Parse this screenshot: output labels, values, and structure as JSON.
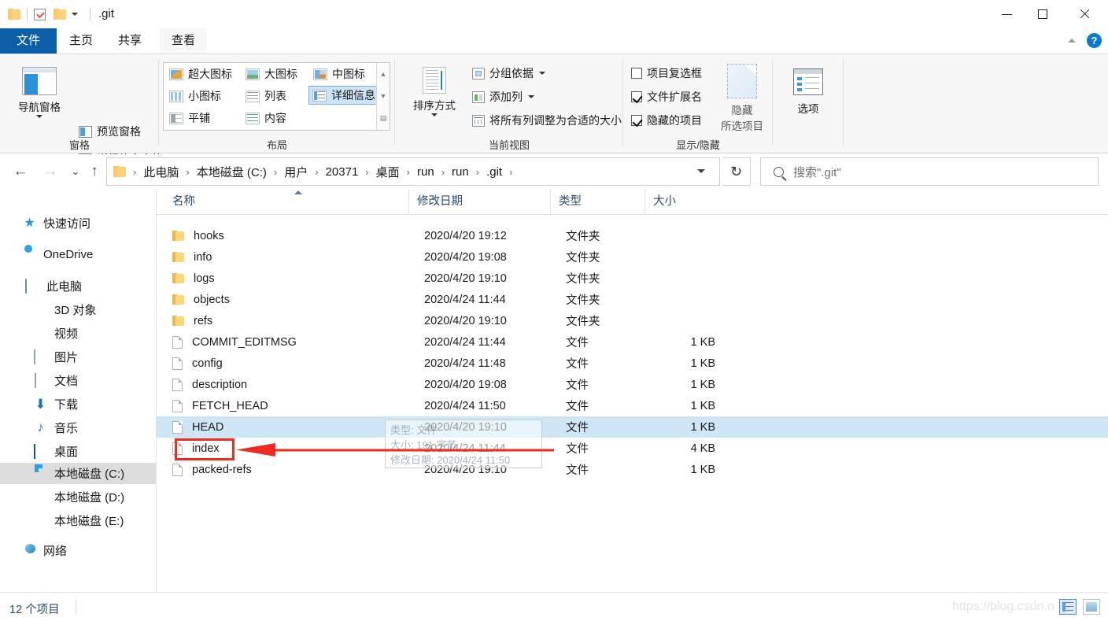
{
  "window": {
    "title": ".git",
    "quick_access": [
      "folder-icon",
      "properties-icon",
      "new-folder-icon"
    ],
    "controls": {
      "minimize": "minimize-icon",
      "maximize": "maximize-icon",
      "close": "close-icon"
    }
  },
  "tabs": [
    {
      "label": "文件",
      "name": "tab-file"
    },
    {
      "label": "主页",
      "name": "tab-home"
    },
    {
      "label": "共享",
      "name": "tab-share"
    },
    {
      "label": "查看",
      "name": "tab-view"
    }
  ],
  "ribbon": {
    "help_label": "?",
    "groups": [
      {
        "label": "窗格",
        "big_button": {
          "label1": "导航窗格",
          "icon": "nav-pane-icon"
        },
        "items": [
          {
            "label": "预览窗格",
            "icon": "preview-pane-icon"
          },
          {
            "label": "详细信息窗格",
            "icon": "details-pane-icon"
          }
        ]
      },
      {
        "label": "布局",
        "views": [
          {
            "label": "超大图标",
            "selected": false
          },
          {
            "label": "大图标",
            "selected": false
          },
          {
            "label": "中图标",
            "selected": false
          },
          {
            "label": "小图标",
            "selected": false
          },
          {
            "label": "列表",
            "selected": false
          },
          {
            "label": "详细信息",
            "selected": true
          },
          {
            "label": "平铺",
            "selected": false
          },
          {
            "label": "内容",
            "selected": false
          }
        ]
      },
      {
        "label": "当前视图",
        "big_button": {
          "label1": "排序方式",
          "icon": "sort-by-icon"
        },
        "items": [
          {
            "label": "分组依据",
            "icon": "group-by-icon",
            "dropdown": true
          },
          {
            "label": "添加列",
            "icon": "add-column-icon",
            "dropdown": true
          },
          {
            "label": "将所有列调整为合适的大小",
            "icon": "fit-columns-icon",
            "dropdown": false
          }
        ]
      },
      {
        "label": "显示/隐藏",
        "checkboxes": [
          {
            "label": "项目复选框",
            "checked": false
          },
          {
            "label": "文件扩展名",
            "checked": true
          },
          {
            "label": "隐藏的项目",
            "checked": true
          }
        ],
        "hide_button": {
          "line1": "隐藏",
          "line2": "所选项目",
          "icon": "hide-selected-icon"
        }
      },
      {
        "label": "",
        "options_button": {
          "label": "选项",
          "icon": "options-icon"
        }
      }
    ]
  },
  "address": {
    "back": "←",
    "forward": "→",
    "recent": "⌄",
    "up": "↑",
    "folder_icon": "folder-icon",
    "crumbs": [
      "此电脑",
      "本地磁盘 (C:)",
      "用户",
      "20371",
      "桌面",
      "run",
      "run",
      ".git"
    ],
    "separator": "›",
    "refresh": "↻"
  },
  "search": {
    "icon": "search-icon",
    "placeholder": "搜索\".git\""
  },
  "navpane": {
    "items": [
      {
        "label": "快速访问",
        "icon": "quick-access-star-icon",
        "indent": 0,
        "selected": false
      },
      {
        "label": "OneDrive",
        "icon": "onedrive-cloud-icon",
        "indent": 0,
        "selected": false
      },
      {
        "label": "此电脑",
        "icon": "this-pc-icon",
        "indent": 0,
        "selected": false
      },
      {
        "label": "3D 对象",
        "icon": "3d-objects-icon",
        "indent": 1,
        "selected": false
      },
      {
        "label": "视频",
        "icon": "videos-icon",
        "indent": 1,
        "selected": false
      },
      {
        "label": "图片",
        "icon": "pictures-icon",
        "indent": 1,
        "selected": false
      },
      {
        "label": "文档",
        "icon": "documents-icon",
        "indent": 1,
        "selected": false
      },
      {
        "label": "下载",
        "icon": "downloads-icon",
        "indent": 1,
        "selected": false
      },
      {
        "label": "音乐",
        "icon": "music-icon",
        "indent": 1,
        "selected": false
      },
      {
        "label": "桌面",
        "icon": "desktop-icon",
        "indent": 1,
        "selected": false
      },
      {
        "label": "本地磁盘 (C:)",
        "icon": "local-disk-c-icon",
        "indent": 1,
        "selected": true
      },
      {
        "label": "本地磁盘 (D:)",
        "icon": "local-disk-icon",
        "indent": 1,
        "selected": false
      },
      {
        "label": "本地磁盘 (E:)",
        "icon": "local-disk-icon",
        "indent": 1,
        "selected": false
      },
      {
        "label": "网络",
        "icon": "network-icon",
        "indent": 0,
        "selected": false
      }
    ]
  },
  "filelist": {
    "columns": [
      {
        "label": "名称",
        "sorted": "asc"
      },
      {
        "label": "修改日期",
        "sorted": ""
      },
      {
        "label": "类型",
        "sorted": ""
      },
      {
        "label": "大小",
        "sorted": ""
      }
    ],
    "rows": [
      {
        "name": "hooks",
        "date": "2020/4/20 19:12",
        "type": "文件夹",
        "size": "",
        "kind": "folder",
        "selected": false
      },
      {
        "name": "info",
        "date": "2020/4/20 19:08",
        "type": "文件夹",
        "size": "",
        "kind": "folder",
        "selected": false
      },
      {
        "name": "logs",
        "date": "2020/4/20 19:10",
        "type": "文件夹",
        "size": "",
        "kind": "folder",
        "selected": false
      },
      {
        "name": "objects",
        "date": "2020/4/24 11:44",
        "type": "文件夹",
        "size": "",
        "kind": "folder",
        "selected": false
      },
      {
        "name": "refs",
        "date": "2020/4/20 19:10",
        "type": "文件夹",
        "size": "",
        "kind": "folder",
        "selected": false
      },
      {
        "name": "COMMIT_EDITMSG",
        "date": "2020/4/24 11:44",
        "type": "文件",
        "size": "1 KB",
        "kind": "file",
        "selected": false
      },
      {
        "name": "config",
        "date": "2020/4/24 11:48",
        "type": "文件",
        "size": "1 KB",
        "kind": "file",
        "selected": false
      },
      {
        "name": "description",
        "date": "2020/4/20 19:08",
        "type": "文件",
        "size": "1 KB",
        "kind": "file",
        "selected": false
      },
      {
        "name": "FETCH_HEAD",
        "date": "2020/4/24 11:50",
        "type": "文件",
        "size": "1 KB",
        "kind": "file",
        "selected": false
      },
      {
        "name": "HEAD",
        "date": "2020/4/20 19:10",
        "type": "文件",
        "size": "1 KB",
        "kind": "file",
        "selected": true
      },
      {
        "name": "index",
        "date": "2020/4/24 11:44",
        "type": "文件",
        "size": "4 KB",
        "kind": "file",
        "selected": false
      },
      {
        "name": "packed-refs",
        "date": "2020/4/20 19:10",
        "type": "文件",
        "size": "1 KB",
        "kind": "file",
        "selected": false
      }
    ]
  },
  "tooltip": {
    "line1": "类型: 文件",
    "line2": "大小: 191 字节",
    "line3": "修改日期: 2020/4/24 11:50"
  },
  "annotation": {
    "color": "#ee2b20",
    "target": "index"
  },
  "statusbar": {
    "count_text": "12 个项目",
    "watermark": "https://blog.csdn.n",
    "view_buttons": [
      {
        "name": "details-view-toggle",
        "active": true
      },
      {
        "name": "thumbnails-view-toggle",
        "active": false
      }
    ]
  }
}
